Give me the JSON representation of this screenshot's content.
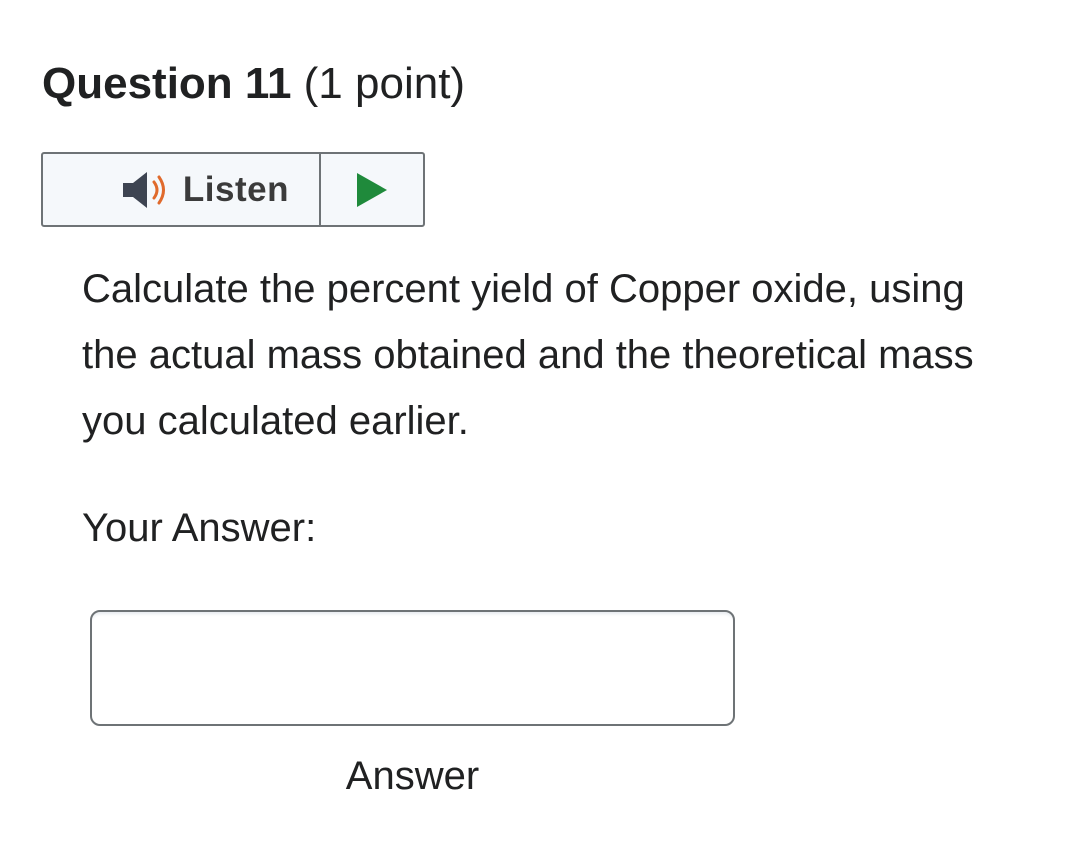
{
  "question": {
    "number_label": "Question 11",
    "points_label": "(1 point)",
    "text": "Calculate the percent yield of Copper oxide, using the actual mass obtained and the theoretical mass you calculated earlier."
  },
  "listen_widget": {
    "label": "Listen",
    "speaker_icon": "speaker-icon",
    "play_icon": "play-icon",
    "colors": {
      "speaker_body": "#3d4451",
      "sound_waves": "#e06a2c",
      "play": "#1f8a3b",
      "background": "#f5f8fb",
      "border": "#6e7376"
    }
  },
  "answer": {
    "label": "Your Answer:",
    "input_value": "",
    "input_caption": "Answer"
  }
}
